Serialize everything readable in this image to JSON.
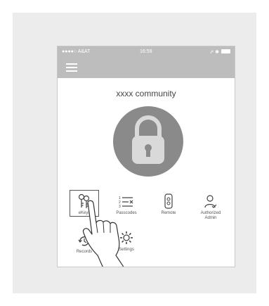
{
  "status_bar": {
    "carrier": "●●●●○ A&AT",
    "time": "16:59",
    "right_icons": "⇗ ✱"
  },
  "header": {
    "menu_icon": "hamburger-menu-icon"
  },
  "main": {
    "community_title": "xxxx community",
    "lock_icon": "padlock-icon",
    "lock_colors": {
      "circle": "#8a8a8a",
      "lock": "#d9d9d9"
    },
    "grid": [
      {
        "label": "eKeys",
        "icon": "ekeys-icon"
      },
      {
        "label": "Passcodes",
        "icon": "passcodes-list-icon"
      },
      {
        "label": "Remote",
        "icon": "remote-icon"
      },
      {
        "label": "Authorized\nAdmin",
        "icon": "authorized-admin-icon"
      },
      {
        "label": "Records",
        "icon": "records-history-icon"
      },
      {
        "label": "Settings",
        "icon": "settings-gear-icon"
      }
    ]
  }
}
